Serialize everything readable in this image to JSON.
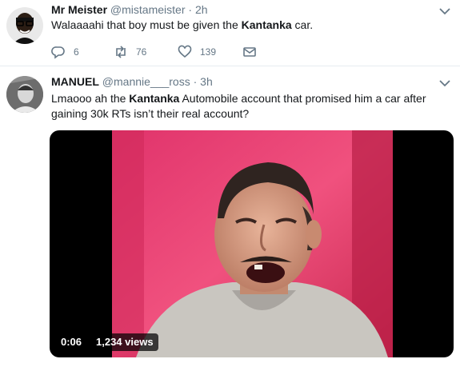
{
  "colors": {
    "text": "#14171a",
    "muted": "#657786",
    "divider": "#e6ecf0",
    "video_bg": "#000000"
  },
  "tweets": [
    {
      "name": "Mr Meister",
      "handle": "@mistameister",
      "dot": "·",
      "time": "2h",
      "text_before": "Walaaaahi that boy must be given the ",
      "text_bold": "Kantanka",
      "text_after": " car.",
      "actions": {
        "reply_icon": "reply-icon",
        "reply_count": "6",
        "retweet_icon": "retweet-icon",
        "retweet_count": "76",
        "like_icon": "heart-icon",
        "like_count": "139",
        "dm_icon": "envelope-icon"
      }
    },
    {
      "name": "MANUEL",
      "handle": "@mannie___ross",
      "dot": "·",
      "time": "3h",
      "text_before": "Lmaooo ah the ",
      "text_bold": "Kantanka",
      "text_after": " Automobile account that promised him a car after gaining 30k RTs isn’t their real account?",
      "video": {
        "duration": "0:06",
        "views": "1,234 views"
      }
    }
  ]
}
